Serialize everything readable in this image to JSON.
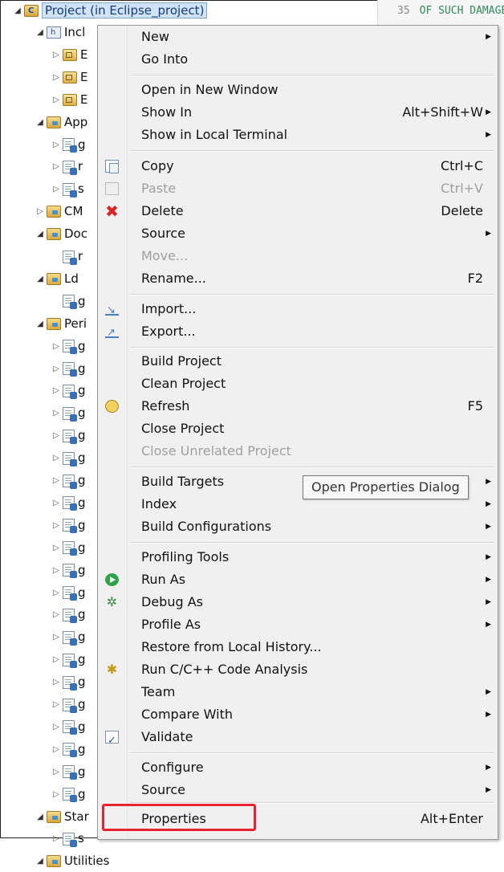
{
  "editor": {
    "line_number": "35",
    "code_text": "OF SUCH DAMAGE."
  },
  "tree": {
    "project_label": "Project (in Eclipse_project)",
    "items": [
      {
        "label": "Incl",
        "kind": "incl",
        "depth": 1,
        "state": "open"
      },
      {
        "label": "E",
        "kind": "libf",
        "depth": 2,
        "state": "closed"
      },
      {
        "label": "E",
        "kind": "libf",
        "depth": 2,
        "state": "closed"
      },
      {
        "label": "E",
        "kind": "libf",
        "depth": 2,
        "state": "closed"
      },
      {
        "label": "App",
        "kind": "folder",
        "depth": 1,
        "state": "open"
      },
      {
        "label": "g",
        "kind": "file",
        "depth": 2,
        "state": "closed"
      },
      {
        "label": "r",
        "kind": "file",
        "depth": 2,
        "state": "closed"
      },
      {
        "label": "s",
        "kind": "file",
        "depth": 2,
        "state": "closed"
      },
      {
        "label": "CM",
        "kind": "folder",
        "depth": 1,
        "state": "closed"
      },
      {
        "label": "Doc",
        "kind": "folder",
        "depth": 1,
        "state": "open"
      },
      {
        "label": "r",
        "kind": "file",
        "depth": 2,
        "state": "none"
      },
      {
        "label": "Ld",
        "kind": "folder",
        "depth": 1,
        "state": "open"
      },
      {
        "label": "g",
        "kind": "file",
        "depth": 2,
        "state": "none"
      },
      {
        "label": "Peri",
        "kind": "folder",
        "depth": 1,
        "state": "open"
      },
      {
        "label": "g",
        "kind": "file",
        "depth": 2,
        "state": "closed"
      },
      {
        "label": "g",
        "kind": "file",
        "depth": 2,
        "state": "closed"
      },
      {
        "label": "g",
        "kind": "file",
        "depth": 2,
        "state": "closed"
      },
      {
        "label": "g",
        "kind": "file",
        "depth": 2,
        "state": "closed"
      },
      {
        "label": "g",
        "kind": "file",
        "depth": 2,
        "state": "closed"
      },
      {
        "label": "g",
        "kind": "file",
        "depth": 2,
        "state": "closed"
      },
      {
        "label": "g",
        "kind": "file",
        "depth": 2,
        "state": "closed"
      },
      {
        "label": "g",
        "kind": "file",
        "depth": 2,
        "state": "closed"
      },
      {
        "label": "g",
        "kind": "file",
        "depth": 2,
        "state": "closed"
      },
      {
        "label": "g",
        "kind": "file",
        "depth": 2,
        "state": "closed"
      },
      {
        "label": "g",
        "kind": "file",
        "depth": 2,
        "state": "closed"
      },
      {
        "label": "g",
        "kind": "file",
        "depth": 2,
        "state": "closed"
      },
      {
        "label": "g",
        "kind": "file",
        "depth": 2,
        "state": "closed"
      },
      {
        "label": "g",
        "kind": "file",
        "depth": 2,
        "state": "closed"
      },
      {
        "label": "g",
        "kind": "file",
        "depth": 2,
        "state": "closed"
      },
      {
        "label": "g",
        "kind": "file",
        "depth": 2,
        "state": "closed"
      },
      {
        "label": "g",
        "kind": "file",
        "depth": 2,
        "state": "closed"
      },
      {
        "label": "g",
        "kind": "file",
        "depth": 2,
        "state": "closed"
      },
      {
        "label": "g",
        "kind": "file",
        "depth": 2,
        "state": "closed"
      },
      {
        "label": "g",
        "kind": "file",
        "depth": 2,
        "state": "closed"
      },
      {
        "label": "g",
        "kind": "file",
        "depth": 2,
        "state": "closed"
      },
      {
        "label": "Star",
        "kind": "folder",
        "depth": 1,
        "state": "open"
      },
      {
        "label": "s",
        "kind": "file",
        "depth": 2,
        "state": "closed"
      },
      {
        "label": "Utilities",
        "kind": "folder",
        "depth": 1,
        "state": "open"
      }
    ]
  },
  "menu": {
    "new": "New",
    "go_into": "Go Into",
    "open_new_window": "Open in New Window",
    "show_in": "Show In",
    "show_in_sc": "Alt+Shift+W",
    "show_local_terminal": "Show in Local Terminal",
    "copy": "Copy",
    "copy_sc": "Ctrl+C",
    "paste": "Paste",
    "paste_sc": "Ctrl+V",
    "delete": "Delete",
    "delete_sc": "Delete",
    "source": "Source",
    "move": "Move...",
    "rename": "Rename...",
    "rename_sc": "F2",
    "import": "Import...",
    "export": "Export...",
    "build_project": "Build Project",
    "clean_project": "Clean Project",
    "refresh": "Refresh",
    "refresh_sc": "F5",
    "close_project": "Close Project",
    "close_unrelated": "Close Unrelated Project",
    "build_targets": "Build Targets",
    "index": "Index",
    "build_configurations": "Build Configurations",
    "profiling_tools": "Profiling Tools",
    "run_as": "Run As",
    "debug_as": "Debug As",
    "profile_as": "Profile As",
    "restore_history": "Restore from Local History...",
    "run_code_analysis": "Run C/C++ Code Analysis",
    "team": "Team",
    "compare_with": "Compare With",
    "validate": "Validate",
    "configure": "Configure",
    "source2": "Source",
    "properties": "Properties",
    "properties_sc": "Alt+Enter"
  },
  "tooltip": "Open Properties Dialog",
  "icons": {
    "copy": "copy-icon",
    "paste": "paste-icon",
    "delete": "delete-icon",
    "import": "import-icon",
    "export": "export-icon",
    "refresh": "refresh-icon",
    "run": "run-icon",
    "debug": "bug-icon",
    "analysis": "code-analysis-icon",
    "validate": "checkbox-icon",
    "submenu": "chevron-right-icon"
  },
  "colors": {
    "highlight": "#e8232d",
    "selection": "#cfe3fb",
    "menu_bg": "#f0f0f0"
  }
}
